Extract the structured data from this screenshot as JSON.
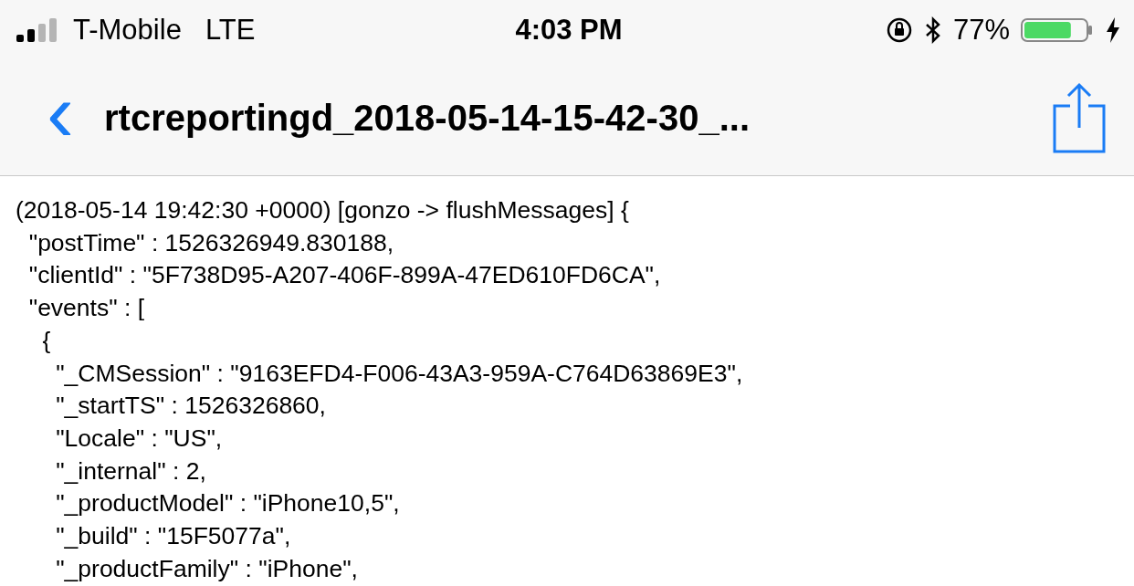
{
  "status_bar": {
    "carrier": "T-Mobile",
    "network": "LTE",
    "time": "4:03 PM",
    "battery_percent": "77%",
    "battery": {
      "level": 0.77,
      "charging": true
    }
  },
  "nav_bar": {
    "back": "‹",
    "title": "rtcreportingd_2018-05-14-15-42-30_..."
  },
  "log_lines": [
    "(2018-05-14 19:42:30 +0000) [gonzo -> flushMessages] {",
    "  \"postTime\" : 1526326949.830188,",
    "  \"clientId\" : \"5F738D95-A207-406F-899A-47ED610FD6CA\",",
    "  \"events\" : [",
    "    {",
    "      \"_CMSession\" : \"9163EFD4-F006-43A3-959A-C764D63869E3\",",
    "      \"_startTS\" : 1526326860,",
    "      \"Locale\" : \"US\",",
    "      \"_internal\" : 2,",
    "      \"_productModel\" : \"iPhone10,5\",",
    "      \"_build\" : \"15F5077a\",",
    "      \"_productFamily\" : \"iPhone\","
  ]
}
